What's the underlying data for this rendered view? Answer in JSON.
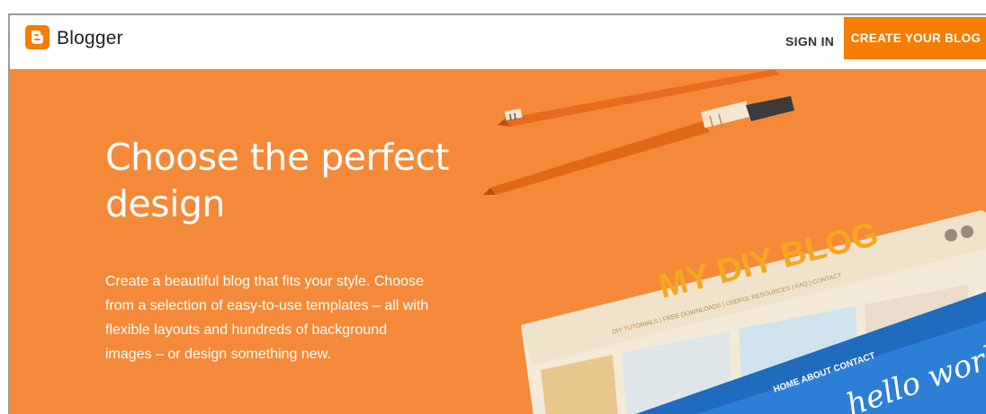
{
  "header": {
    "logo_text": "Blogger",
    "signin_label": "SIGN IN",
    "create_label": "CREATE YOUR BLOG"
  },
  "hero": {
    "title": "Choose the perfect design",
    "description": "Create a beautiful blog that fits your style. Choose from a selection of easy-to-use templates – all with flexible layouts and hundreds of background images – or design something new."
  },
  "illustration": {
    "blog_title": "MY DIY BLOG",
    "blog_nav": [
      "DIY TUTORIALS",
      "FREE DOWNLOADS",
      "USEFUL RESOURCES",
      "FAQ",
      "CONTACT"
    ],
    "blue_nav": [
      "HOME",
      "ABOUT",
      "CONTACT"
    ],
    "blue_script": "hello world"
  },
  "colors": {
    "brand": "#f57d00",
    "hero_bg": "#f48a39",
    "blue_template": "#2d7fd6"
  },
  "icons": {
    "logo": "blogger-logo-icon",
    "social": [
      "google-plus-icon",
      "facebook-icon"
    ]
  }
}
